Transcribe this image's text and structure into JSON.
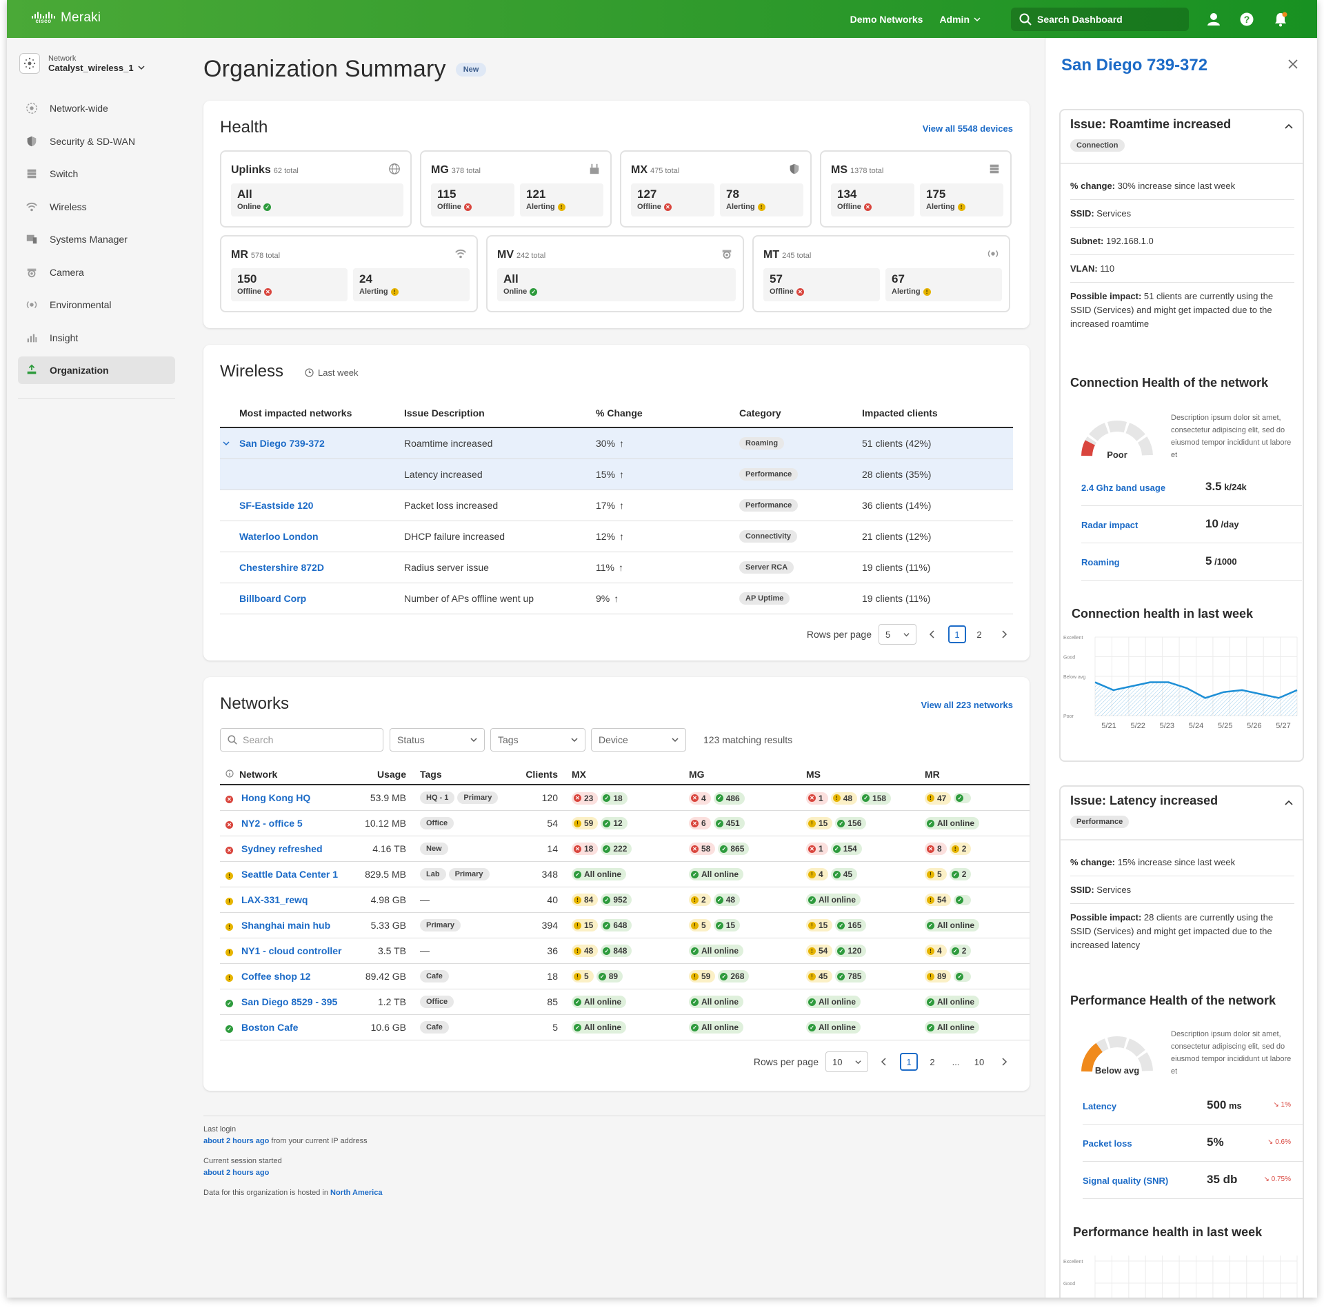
{
  "topbar": {
    "brand_word": "cisco",
    "brand_name": "Meraki",
    "demo_networks": "Demo Networks",
    "admin": "Admin",
    "search": "Search Dashboard"
  },
  "sidebar": {
    "network_label": "Network",
    "network_value": "Catalyst_wireless_1",
    "items": [
      {
        "label": "Network-wide",
        "icon": "network-wide-icon"
      },
      {
        "label": "Security & SD-WAN",
        "icon": "shield-icon"
      },
      {
        "label": "Switch",
        "icon": "switch-icon"
      },
      {
        "label": "Wireless",
        "icon": "wifi-icon"
      },
      {
        "label": "Systems Manager",
        "icon": "systems-manager-icon"
      },
      {
        "label": "Camera",
        "icon": "camera-icon"
      },
      {
        "label": "Environmental",
        "icon": "sensor-icon"
      },
      {
        "label": "Insight",
        "icon": "insight-icon"
      },
      {
        "label": "Organization",
        "icon": "organization-icon",
        "active": true
      }
    ]
  },
  "page": {
    "title": "Organization Summary",
    "badge": "New"
  },
  "health": {
    "title": "Health",
    "view_all": "View all 5548 devices",
    "tiles": [
      {
        "name": "Uplinks",
        "total": "62 total",
        "icon": "globe-icon",
        "boxes": [
          {
            "n": "All",
            "s": "Online",
            "st": "g"
          }
        ]
      },
      {
        "name": "MG",
        "total": "378 total",
        "icon": "cellular-gateway-icon",
        "boxes": [
          {
            "n": "115",
            "s": "Offline",
            "st": "r"
          },
          {
            "n": "121",
            "s": "Alerting",
            "st": "y"
          }
        ]
      },
      {
        "name": "MX",
        "total": "475 total",
        "icon": "shield-icon",
        "boxes": [
          {
            "n": "127",
            "s": "Offline",
            "st": "r"
          },
          {
            "n": "78",
            "s": "Alerting",
            "st": "y"
          }
        ]
      },
      {
        "name": "MS",
        "total": "1378 total",
        "icon": "switch-icon",
        "boxes": [
          {
            "n": "134",
            "s": "Offline",
            "st": "r"
          },
          {
            "n": "175",
            "s": "Alerting",
            "st": "y"
          }
        ]
      },
      {
        "name": "MR",
        "total": "578 total",
        "icon": "wifi-icon",
        "boxes": [
          {
            "n": "150",
            "s": "Offline",
            "st": "r"
          },
          {
            "n": "24",
            "s": "Alerting",
            "st": "y"
          }
        ]
      },
      {
        "name": "MV",
        "total": "242 total",
        "icon": "camera-icon",
        "boxes": [
          {
            "n": "All",
            "s": "Online",
            "st": "g"
          }
        ]
      },
      {
        "name": "MT",
        "total": "245 total",
        "icon": "sensor-icon",
        "boxes": [
          {
            "n": "57",
            "s": "Offline",
            "st": "r"
          },
          {
            "n": "67",
            "s": "Alerting",
            "st": "y"
          }
        ]
      }
    ]
  },
  "wireless": {
    "title": "Wireless",
    "period": "Last week",
    "columns": [
      "Most impacted networks",
      "Issue Description",
      "% Change",
      "Category",
      "Impacted clients"
    ],
    "rows": [
      {
        "network": "San Diego 739-372",
        "issue": "Roamtime increased",
        "change": "30%",
        "category": "Roaming",
        "clients": "51 clients (42%)",
        "expanded": true
      },
      {
        "network": "",
        "issue": "Latency increased",
        "change": "15%",
        "category": "Performance",
        "clients": "28 clients (35%)",
        "sub": true
      },
      {
        "network": "SF-Eastside 120",
        "issue": "Packet loss increased",
        "change": "17%",
        "category": "Performance",
        "clients": "36 clients (14%)"
      },
      {
        "network": "Waterloo London",
        "issue": "DHCP failure increased",
        "change": "12%",
        "category": "Connectivity",
        "clients": "21 clients (12%)"
      },
      {
        "network": "Chestershire 872D",
        "issue": "Radius server issue",
        "change": "11%",
        "category": "Server RCA",
        "clients": "19 clients (11%)"
      },
      {
        "network": "Billboard Corp",
        "issue": "Number of APs offline went up",
        "change": "9%",
        "category": "AP Uptime",
        "clients": "19 clients (11%)"
      }
    ],
    "rows_per_page_label": "Rows per page",
    "rows_per_page": "5",
    "pages": [
      "1",
      "2"
    ]
  },
  "networks": {
    "title": "Networks",
    "view_all": "View all 223 networks",
    "search_placeholder": "Search",
    "filters": [
      "Status",
      "Tags",
      "Device"
    ],
    "matching": "123 matching results",
    "columns": [
      "Network",
      "Usage",
      "Tags",
      "Clients",
      "MX",
      "MG",
      "MS",
      "MR"
    ],
    "rows": [
      {
        "st": "r",
        "name": "Hong Kong HQ",
        "usage": "53.9 MB",
        "tags": [
          "HQ - 1",
          "Primary"
        ],
        "clients": "120",
        "mx": [
          [
            "r",
            "23"
          ],
          [
            "g",
            "18"
          ]
        ],
        "mg": [
          [
            "r",
            "4"
          ],
          [
            "g",
            "486"
          ]
        ],
        "ms": [
          [
            "r",
            "1"
          ],
          [
            "y",
            "48"
          ],
          [
            "g",
            "158"
          ]
        ],
        "mr": [
          [
            "y",
            "47"
          ],
          [
            "g",
            ""
          ]
        ]
      },
      {
        "st": "r",
        "name": "NY2 - office 5",
        "usage": "10.12 MB",
        "tags": [
          "Office"
        ],
        "clients": "54",
        "mx": [
          [
            "y",
            "59"
          ],
          [
            "g",
            "12"
          ]
        ],
        "mg": [
          [
            "r",
            "6"
          ],
          [
            "g",
            "451"
          ]
        ],
        "ms": [
          [
            "y",
            "15"
          ],
          [
            "g",
            "156"
          ]
        ],
        "mr": [
          [
            "g",
            "All online"
          ]
        ]
      },
      {
        "st": "r",
        "name": "Sydney refreshed",
        "usage": "4.16 TB",
        "tags": [
          "New"
        ],
        "clients": "14",
        "mx": [
          [
            "r",
            "18"
          ],
          [
            "g",
            "222"
          ]
        ],
        "mg": [
          [
            "r",
            "58"
          ],
          [
            "g",
            "865"
          ]
        ],
        "ms": [
          [
            "r",
            "1"
          ],
          [
            "g",
            "154"
          ]
        ],
        "mr": [
          [
            "r",
            "8"
          ],
          [
            "y",
            "2"
          ]
        ]
      },
      {
        "st": "y",
        "name": "Seattle Data Center 1",
        "usage": "829.5 MB",
        "tags": [
          "Lab",
          "Primary"
        ],
        "clients": "348",
        "mx": [
          [
            "g",
            "All online"
          ]
        ],
        "mg": [
          [
            "g",
            "All online"
          ]
        ],
        "ms": [
          [
            "y",
            "4"
          ],
          [
            "g",
            "45"
          ]
        ],
        "mr": [
          [
            "y",
            "5"
          ],
          [
            "g",
            "2"
          ]
        ]
      },
      {
        "st": "y",
        "name": "LAX-331_rewq",
        "usage": "4.98 GB",
        "tags": [
          "—"
        ],
        "clients": "40",
        "mx": [
          [
            "y",
            "84"
          ],
          [
            "g",
            "952"
          ]
        ],
        "mg": [
          [
            "y",
            "2"
          ],
          [
            "g",
            "48"
          ]
        ],
        "ms": [
          [
            "g",
            "All online"
          ]
        ],
        "mr": [
          [
            "y",
            "54"
          ],
          [
            "g",
            ""
          ]
        ]
      },
      {
        "st": "y",
        "name": "Shanghai main hub",
        "usage": "5.33 GB",
        "tags": [
          "Primary"
        ],
        "clients": "394",
        "mx": [
          [
            "y",
            "15"
          ],
          [
            "g",
            "648"
          ]
        ],
        "mg": [
          [
            "y",
            "5"
          ],
          [
            "g",
            "15"
          ]
        ],
        "ms": [
          [
            "y",
            "15"
          ],
          [
            "g",
            "165"
          ]
        ],
        "mr": [
          [
            "g",
            "All online"
          ]
        ]
      },
      {
        "st": "y",
        "name": "NY1 - cloud controller",
        "usage": "3.5 TB",
        "tags": [
          "—"
        ],
        "clients": "36",
        "mx": [
          [
            "y",
            "48"
          ],
          [
            "g",
            "848"
          ]
        ],
        "mg": [
          [
            "g",
            "All online"
          ]
        ],
        "ms": [
          [
            "y",
            "54"
          ],
          [
            "g",
            "120"
          ]
        ],
        "mr": [
          [
            "y",
            "4"
          ],
          [
            "g",
            "2"
          ]
        ]
      },
      {
        "st": "y",
        "name": "Coffee shop 12",
        "usage": "89.42 GB",
        "tags": [
          "Cafe"
        ],
        "clients": "18",
        "mx": [
          [
            "y",
            "5"
          ],
          [
            "g",
            "89"
          ]
        ],
        "mg": [
          [
            "y",
            "59"
          ],
          [
            "g",
            "268"
          ]
        ],
        "ms": [
          [
            "y",
            "45"
          ],
          [
            "g",
            "785"
          ]
        ],
        "mr": [
          [
            "y",
            "89"
          ],
          [
            "g",
            ""
          ]
        ]
      },
      {
        "st": "g",
        "name": "San Diego 8529 - 395",
        "usage": "1.2 TB",
        "tags": [
          "Office"
        ],
        "clients": "85",
        "mx": [
          [
            "g",
            "All online"
          ]
        ],
        "mg": [
          [
            "g",
            "All online"
          ]
        ],
        "ms": [
          [
            "g",
            "All online"
          ]
        ],
        "mr": [
          [
            "g",
            "All online"
          ]
        ]
      },
      {
        "st": "g",
        "name": "Boston Cafe",
        "usage": "10.6 GB",
        "tags": [
          "Cafe"
        ],
        "clients": "5",
        "mx": [
          [
            "g",
            "All online"
          ]
        ],
        "mg": [
          [
            "g",
            "All online"
          ]
        ],
        "ms": [
          [
            "g",
            "All online"
          ]
        ],
        "mr": [
          [
            "g",
            "All online"
          ]
        ]
      }
    ],
    "rows_per_page_label": "Rows per page",
    "rows_per_page": "10",
    "pages": [
      "1",
      "2",
      "...",
      "10"
    ]
  },
  "footer": {
    "last_login_label": "Last login",
    "last_login_value": "about 2 hours ago",
    "last_login_suffix": " from your current IP address",
    "session_label": "Current session started",
    "session_value": "about 2 hours ago",
    "hosted_prefix": "Data for this organization is hosted in ",
    "hosted_region": "North America"
  },
  "panel": {
    "title": "San Diego 739-372",
    "issue1": {
      "title": "Issue: Roamtime increased",
      "tag": "Connection",
      "change_label": "% change:",
      "change_value": " 30% increase since last week",
      "ssid_label": "SSID:",
      "ssid_value": "  Services",
      "subnet_label": "Subnet:",
      "subnet_value": " 192.168.1.0",
      "vlan_label": "VLAN:",
      "vlan_value": " 110",
      "impact_label": "Possible impact:",
      "impact_value": " 51 clients are currently using the SSID (Services) and might get impacted due to the increased roamtime",
      "health_title": "Connection Health of the network",
      "gauge_label": "Poor",
      "gauge_level": 0.15,
      "gauge_color": "#d9453d",
      "desc": "Description ipsum dolor sit amet, consectetur adipiscing elit, sed do eiusmod tempor incididunt ut labore et",
      "metrics": [
        {
          "label": "2.4 Ghz band usage",
          "value": "3.5",
          "unit": " k/24k"
        },
        {
          "label": "Radar impact",
          "value": "10",
          "unit": " /day"
        },
        {
          "label": "Roaming",
          "value": "5",
          "unit": " /1000"
        }
      ],
      "chart_title": "Connection health in last week"
    },
    "issue2": {
      "title": "Issue: Latency increased",
      "tag": "Performance",
      "change_label": "% change:",
      "change_value": " 15% increase since last week",
      "ssid_label": "SSID:",
      "ssid_value": "  Services",
      "impact_label": "Possible impact:",
      "impact_value": " 28 clients are currently using the SSID (Services) and might get impacted due to the increased latency",
      "health_title": "Performance Health of the network",
      "gauge_label": "Below avg",
      "gauge_level": 0.3,
      "gauge_color": "#f08a1c",
      "desc": "Description ipsum dolor sit amet, consectetur adipiscing elit, sed do eiusmod tempor incididunt ut labore et",
      "metrics": [
        {
          "label": "Latency",
          "value": "500",
          "unit": " ms",
          "delta": "↘ 1%"
        },
        {
          "label": "Packet loss",
          "value": "5%",
          "unit": "",
          "delta": "↘ 0.6%"
        },
        {
          "label": "Signal quality (SNR)",
          "value": "35 db",
          "unit": "",
          "delta": "↘ 0.75%"
        }
      ],
      "chart_title": "Performance health in last week"
    }
  },
  "chart_data": [
    {
      "type": "area",
      "title": "Connection health in last week",
      "y_categories": [
        "Poor",
        "Below avg",
        "Good",
        "Excellent"
      ],
      "x": [
        "5/21",
        "5/22",
        "5/23",
        "5/24",
        "5/25",
        "5/26",
        "5/27"
      ],
      "series": [
        {
          "values": [
            1.7,
            1.3,
            1.5,
            1.7,
            1.7,
            1.4,
            0.9,
            1.2,
            1.3,
            1.1,
            0.9,
            1.3
          ]
        }
      ],
      "ylim": [
        0,
        4
      ],
      "grid": true,
      "color": "#1e8fd6"
    },
    {
      "type": "area",
      "title": "Performance health in last week",
      "y_categories": [
        "Excellent",
        "Good"
      ],
      "grid": true,
      "color": "#1e8fd6"
    }
  ]
}
